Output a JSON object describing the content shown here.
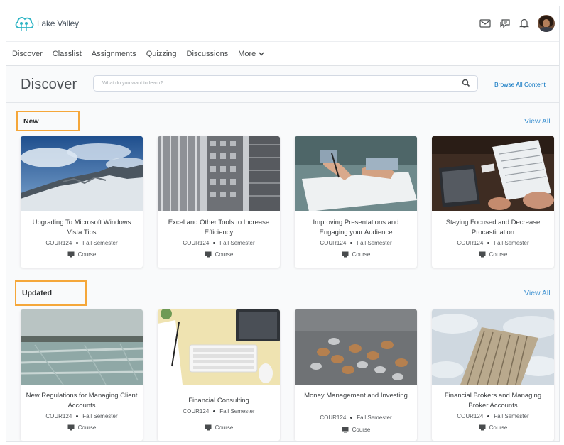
{
  "app": {
    "logo_text": "Lake Valley"
  },
  "header_icons": [
    "mail-icon",
    "chat-icon",
    "bell-icon"
  ],
  "nav": {
    "items": [
      "Discover",
      "Classlist",
      "Assignments",
      "Quizzing",
      "Discussions"
    ],
    "more_label": "More"
  },
  "page": {
    "title": "Discover",
    "search_placeholder": "What do you want to learn?",
    "browse_all": "Browse All Content"
  },
  "sections": [
    {
      "label": "New",
      "view_all": "View All",
      "cards": [
        {
          "title": "Upgrading To Microsoft Windows Vista Tips",
          "code": "COUR124",
          "term": "Fall Semester",
          "type": "Course"
        },
        {
          "title": "Excel and Other Tools to Increase Efficiency",
          "code": "COUR124",
          "term": "Fall Semester",
          "type": "Course"
        },
        {
          "title": "Improving Presentations and Engaging your Audience",
          "code": "COUR124",
          "term": "Fall Semester",
          "type": "Course"
        },
        {
          "title": "Staying Focused and Decrease Procastination",
          "code": "COUR124",
          "term": "Fall Semester",
          "type": "Course"
        }
      ]
    },
    {
      "label": "Updated",
      "view_all": "View All",
      "cards": [
        {
          "title": "New Regulations for Managing Client Accounts",
          "code": "COUR124",
          "term": "Fall Semester",
          "type": "Course"
        },
        {
          "title": "Financial Consulting",
          "code": "COUR124",
          "term": "Fall Semester",
          "type": "Course"
        },
        {
          "title": "Money Management and Investing",
          "code": "COUR124",
          "term": "Fall Semester",
          "type": "Course"
        },
        {
          "title": "Financial Brokers and Managing Broker Accounts",
          "code": "COUR124",
          "term": "Fall Semester",
          "type": "Course"
        }
      ]
    }
  ],
  "colors": {
    "accent_link": "#006fbf",
    "section_highlight": "#f5a73a",
    "logo_teal": "#2db4c4"
  }
}
